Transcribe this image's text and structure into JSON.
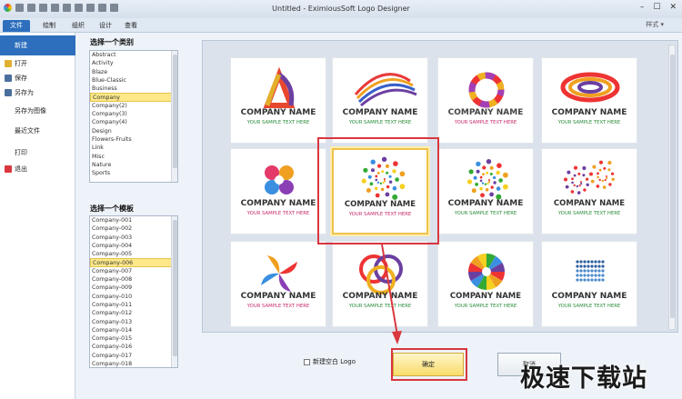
{
  "window": {
    "title": "Untitled - EximiousSoft Logo Designer",
    "controls": [
      "–",
      "☐",
      "✕"
    ]
  },
  "ribbon": {
    "tabs": [
      "文件",
      "绘制",
      "组织",
      "设计",
      "查看"
    ],
    "style_label": "样式 ▾"
  },
  "leftmenu": {
    "items": [
      {
        "label": "新建",
        "icon": "new-icon",
        "color": "#2d6fbd"
      },
      {
        "label": "打开",
        "icon": "open-folder-icon",
        "color": "#e0b030"
      },
      {
        "label": "保存",
        "icon": "save-disk-icon",
        "color": "#4a6f9c"
      },
      {
        "label": "另存为",
        "icon": "save-as-icon",
        "color": "#4a6f9c"
      },
      {
        "label": "另存为图像",
        "icon": "",
        "color": ""
      },
      {
        "label": "最近文件",
        "icon": "",
        "color": ""
      },
      {
        "label": "打印",
        "icon": "",
        "color": ""
      },
      {
        "label": "退出",
        "icon": "exit-icon",
        "color": "#d9363e"
      }
    ]
  },
  "categories": {
    "heading": "选择一个类别",
    "items": [
      "Abstract",
      "Activity",
      "Blaze",
      "Blue-Classic",
      "Business",
      "Company",
      "Company(2)",
      "Company(3)",
      "Company(4)",
      "Design",
      "Flowers-Fruits",
      "Link",
      "Misc",
      "Nature",
      "Sports"
    ],
    "selected": "Company"
  },
  "templates": {
    "heading": "选择一个模板",
    "items": [
      "Company-001",
      "Company-002",
      "Company-003",
      "Company-004",
      "Company-005",
      "Company-006",
      "Company-007",
      "Company-008",
      "Company-009",
      "Company-010",
      "Company-011",
      "Company-012",
      "Company-013",
      "Company-014",
      "Company-015",
      "Company-016",
      "Company-017",
      "Company-018"
    ],
    "selected": "Company-006"
  },
  "gallery": {
    "cards": [
      {
        "name": "COMPANY NAME",
        "sub": "YOUR SAMPLE TEXT HERE",
        "name_color": "#333",
        "sub_color": "#2a8c3a",
        "logo": "triangle-swirl-logo"
      },
      {
        "name": "COMPANY NAME",
        "sub": "YOUR SAMPLE TEXT HERE",
        "name_color": "#333",
        "sub_color": "#2a8c3a",
        "logo": "wing-stripes-logo"
      },
      {
        "name": "COMPANY NAME",
        "sub": "YOUR SAMPLE TEXT HERE",
        "name_color": "#444",
        "sub_color": "#c62a6a",
        "logo": "rainbow-ring-logo"
      },
      {
        "name": "COMPANY NAME",
        "sub": "YOUR SAMPLE TEXT HERE",
        "name_color": "#333",
        "sub_color": "#2a8c3a",
        "logo": "orbit-swirl-logo"
      },
      {
        "name": "COMPANY NAME",
        "sub": "YOUR SAMPLE TEXT HERE",
        "name_color": "#333",
        "sub_color": "#c62a6a",
        "logo": "hearts-flower-logo"
      },
      {
        "name": "COMPANY NAME",
        "sub": "YOUR SAMPLE TEXT HERE",
        "name_color": "#333",
        "sub_color": "#c62a6a",
        "logo": "dot-spiral-logo"
      },
      {
        "name": "COMPANY NAME",
        "sub": "YOUR SAMPLE TEXT HERE",
        "name_color": "#333",
        "sub_color": "#2a8c3a",
        "logo": "dot-swirl-logo"
      },
      {
        "name": "COMPANY NAME",
        "sub": "YOUR SAMPLE TEXT HERE",
        "name_color": "#333",
        "sub_color": "#2a8c3a",
        "logo": "dot-spirals-logo"
      },
      {
        "name": "COMPANY NAME",
        "sub": "YOUR SAMPLE TEXT HERE",
        "name_color": "#333",
        "sub_color": "#c62a6a",
        "logo": "pinwheel-logo"
      },
      {
        "name": "COMPANY NAME",
        "sub": "YOUR SAMPLE TEXT HERE",
        "name_color": "#333",
        "sub_color": "#2a8c3a",
        "logo": "ring-links-logo"
      },
      {
        "name": "COMPANY NAME",
        "sub": "YOUR SAMPLE TEXT HERE",
        "name_color": "#333",
        "sub_color": "#2a8c3a",
        "logo": "color-wheel-logo"
      },
      {
        "name": "COMPANY NAME",
        "sub": "YOUR SAMPLE TEXT HERE",
        "name_color": "#333",
        "sub_color": "#2a8c3a",
        "logo": "dot-globe-logo"
      }
    ]
  },
  "bottom": {
    "blank_logo_label": "新建空白 Logo",
    "ok_label": "确定",
    "cancel_label": "取消"
  },
  "watermark": "极速下载站"
}
